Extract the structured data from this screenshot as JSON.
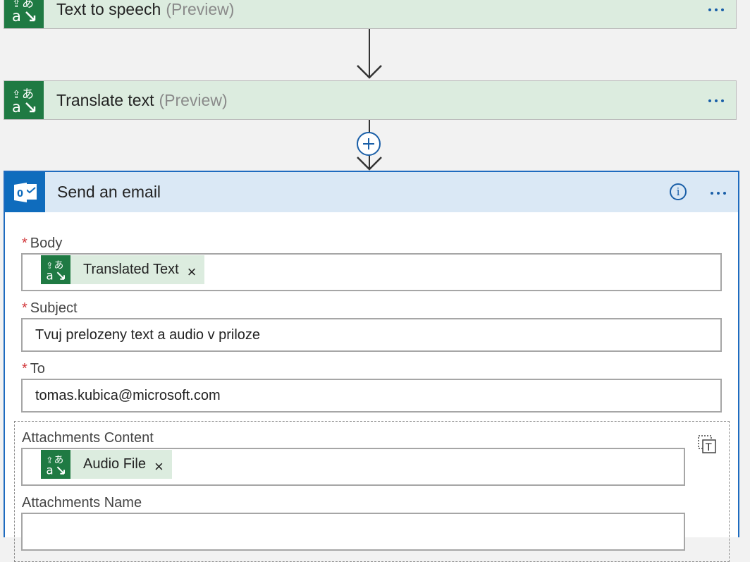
{
  "colors": {
    "translator_green": "#1f7a43",
    "token_bg": "#dcecdf",
    "outlook_blue": "#0f6cbd",
    "accent_blue": "#1a5fa8",
    "required_red": "#d13438"
  },
  "steps": {
    "text_to_speech": {
      "title": "Text to speech",
      "tag": "(Preview)",
      "icon": "translator-icon"
    },
    "translate_text": {
      "title": "Translate text",
      "tag": "(Preview)",
      "icon": "translator-icon"
    }
  },
  "email": {
    "title": "Send an email",
    "icon": "outlook-icon",
    "body": {
      "label": "Body",
      "required_mark": "*",
      "token": "Translated Text",
      "token_close": "×"
    },
    "subject": {
      "label": "Subject",
      "required_mark": "*",
      "value": "Tvuj prelozeny text a audio v priloze"
    },
    "to": {
      "label": "To",
      "required_mark": "*",
      "value": "tomas.kubica@microsoft.com"
    },
    "attachments_content": {
      "label": "Attachments Content",
      "token": "Audio File",
      "token_close": "×"
    },
    "attachments_name": {
      "label": "Attachments Name"
    }
  }
}
